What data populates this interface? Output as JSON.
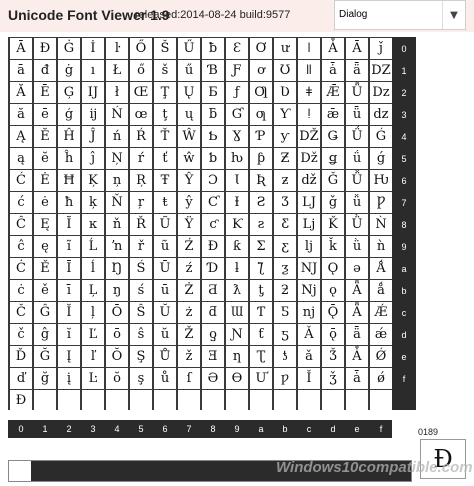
{
  "app": {
    "title": "Unicode Font Viewer 1.9",
    "release_info": "released:2014-08-24 build:9577"
  },
  "font_select": {
    "value": "Dialog",
    "arrow_icon": "chevron-down-icon"
  },
  "grid": {
    "rows": [
      [
        "Ā",
        "Đ",
        "Ġ",
        "İ",
        "ŀ",
        "Ő",
        "Š",
        "Ű",
        "ƀ",
        "Ɛ",
        "Ơ",
        "ư",
        "ǀ",
        "Ǡ",
        "Ā",
        "ǰ"
      ],
      [
        "ā",
        "đ",
        "ġ",
        "ı",
        "Ł",
        "ő",
        "š",
        "ű",
        "Ɓ",
        "Ƒ",
        "ơ",
        "Ʊ",
        "ǁ",
        "ǡ",
        "ǟ",
        "Ǳ"
      ],
      [
        "Ă",
        "Ē",
        "Ģ",
        "Ĳ",
        "ł",
        "Œ",
        "Ţ",
        "Ų",
        "Ƃ",
        "ƒ",
        "Ƣ",
        "Ʋ",
        "ǂ",
        "Ǣ",
        "Ǖ",
        "ǲ"
      ],
      [
        "ă",
        "ē",
        "ģ",
        "ĳ",
        "Ń",
        "œ",
        "ţ",
        "ų",
        "ƃ",
        "Ɠ",
        "ƣ",
        "Ƴ",
        "ǃ",
        "ǣ",
        "ǖ",
        "ǳ"
      ],
      [
        "Ą",
        "Ĕ",
        "Ĥ",
        "Ĵ",
        "ń",
        "Ŕ",
        "Ť",
        "Ŵ",
        "Ƅ",
        "Ɣ",
        "Ƥ",
        "ƴ",
        "Ǆ",
        "Ǥ",
        "Ǘ",
        "Ǵ"
      ],
      [
        "ą",
        "ĕ",
        "ĥ",
        "ĵ",
        "Ņ",
        "ŕ",
        "ť",
        "ŵ",
        "ƅ",
        "ƕ",
        "ƥ",
        "Ƶ",
        "ǅ",
        "ǥ",
        "ǘ",
        "ǵ"
      ],
      [
        "Ć",
        "Ė",
        "Ħ",
        "Ķ",
        "ņ",
        "Ŗ",
        "Ŧ",
        "Ŷ",
        "Ɔ",
        "Ɩ",
        "Ʀ",
        "ƶ",
        "ǆ",
        "Ǧ",
        "Ǚ",
        "Ƕ"
      ],
      [
        "ć",
        "ė",
        "ħ",
        "ķ",
        "Ň",
        "ŗ",
        "ŧ",
        "ŷ",
        "Ƈ",
        "Ɨ",
        "Ƨ",
        "Ʒ",
        "Ǉ",
        "ǧ",
        "ǚ",
        "Ƿ"
      ],
      [
        "Ĉ",
        "Ę",
        "Ĩ",
        "ĸ",
        "ň",
        "Ř",
        "Ũ",
        "Ÿ",
        "ƈ",
        "Ƙ",
        "ƨ",
        "Ƹ",
        "ǈ",
        "Ǩ",
        "Ǜ",
        "Ǹ"
      ],
      [
        "ĉ",
        "ę",
        "ĩ",
        "Ĺ",
        "ŉ",
        "ř",
        "ũ",
        "Ź",
        "Ɖ",
        "ƙ",
        "Ʃ",
        "ƹ",
        "ǉ",
        "ǩ",
        "ǜ",
        "ǹ"
      ],
      [
        "Ċ",
        "Ě",
        "Ī",
        "ĺ",
        "Ŋ",
        "Ś",
        "Ū",
        "ź",
        "Ɗ",
        "ƚ",
        "ƪ",
        "ƺ",
        "Ǌ",
        "Ǫ",
        "ǝ",
        "Ǻ"
      ],
      [
        "ċ",
        "ě",
        "ī",
        "Ļ",
        "ŋ",
        "ś",
        "ū",
        "Ż",
        "Ƌ",
        "ƛ",
        "ƫ",
        "ƻ",
        "ǋ",
        "ǫ",
        "Ǟ",
        "ǻ"
      ],
      [
        "Č",
        "Ĝ",
        "Ĭ",
        "ļ",
        "Ō",
        "Ŝ",
        "Ŭ",
        "ż",
        "ƌ",
        "Ɯ",
        "Ƭ",
        "Ƽ",
        "ǌ",
        "Ǭ",
        "Ǟ",
        "Ǽ"
      ],
      [
        "č",
        "ĝ",
        "ĭ",
        "Ľ",
        "ō",
        "ŝ",
        "ŭ",
        "Ž",
        "ƍ",
        "Ɲ",
        "ƭ",
        "ƽ",
        "Ǎ",
        "ǭ",
        "ǟ",
        "ǽ"
      ],
      [
        "Ď",
        "Ğ",
        "Į",
        "ľ",
        "Ŏ",
        "Ş",
        "Ů",
        "ž",
        "Ǝ",
        "ƞ",
        "Ʈ",
        "ƾ",
        "ǎ",
        "Ǯ",
        "Ǡ",
        "Ǿ"
      ],
      [
        "ď",
        "ğ",
        "į",
        "Ŀ",
        "ŏ",
        "ş",
        "ů",
        "ſ",
        "Ə",
        "Ɵ",
        "Ư",
        "ƿ",
        "Ǐ",
        "ǯ",
        "ǡ",
        "ǿ"
      ],
      [
        "Đ",
        "",
        "",
        "",
        "",
        "",
        "",
        "",
        "",
        "",
        "",
        "",
        "",
        "",
        "",
        ""
      ]
    ],
    "row_labels": [
      "0",
      "1",
      "2",
      "3",
      "4",
      "5",
      "6",
      "7",
      "8",
      "9",
      "a",
      "b",
      "c",
      "d",
      "e",
      "f",
      ""
    ],
    "col_labels": [
      "0",
      "1",
      "2",
      "3",
      "4",
      "5",
      "6",
      "7",
      "8",
      "9",
      "a",
      "b",
      "c",
      "d",
      "e",
      "f"
    ]
  },
  "selection": {
    "code": "0189",
    "glyph": "Đ"
  },
  "watermark": "Windows10compatible.com"
}
